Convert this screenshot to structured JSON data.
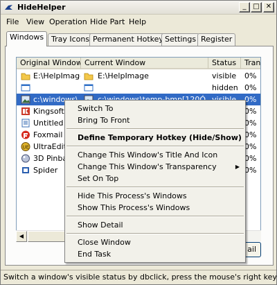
{
  "window": {
    "title": "HideHelper"
  },
  "menubar": [
    "File",
    "View",
    "Operation",
    "Hide Part",
    "Help"
  ],
  "tabs": [
    "Windows",
    "Tray Icons",
    "Permanent Hotkeys",
    "Settings",
    "Register"
  ],
  "list": {
    "columns": [
      "Original Window",
      "Current Window",
      "Status",
      "Tran"
    ],
    "rows": [
      {
        "original": "E:\\HelpImage",
        "current": "E:\\HelpImage",
        "status": "visible",
        "trans": "0%",
        "icon": "folder-icon"
      },
      {
        "original": "",
        "current": "",
        "status": "hidden",
        "trans": "0%",
        "icon": "blank-window-icon"
      },
      {
        "original": "c:\\windows\\",
        "current": "c:\\windows\\temp-bmp[120Ó",
        "status": "visible",
        "trans": "0%",
        "icon": "image-icon",
        "selected": true
      },
      {
        "original": "Kingsoft I",
        "current": "",
        "status": "",
        "trans": "0%",
        "icon": "kingsoft-icon"
      },
      {
        "original": "Untitled -",
        "current": "",
        "status": "",
        "trans": "0%",
        "icon": "notepad-icon"
      },
      {
        "original": "Foxmail",
        "current": "",
        "status": "",
        "trans": "0%",
        "icon": "foxmail-icon"
      },
      {
        "original": "UltraEdit-",
        "current": "",
        "status": "",
        "trans": "0%",
        "icon": "ultraedit-icon"
      },
      {
        "original": "3D Pinbal",
        "current": "",
        "status": "",
        "trans": "0%",
        "icon": "pinball-icon"
      },
      {
        "original": "Spider",
        "current": "",
        "status": "",
        "trans": "0%",
        "icon": "spider-icon"
      }
    ]
  },
  "detail_button": {
    "label": "ail"
  },
  "status_bar": {
    "text": "Switch a window's visible status by dbclick, press the mouse's right key to pop c"
  },
  "context_menu": {
    "items": [
      {
        "label": "Switch To"
      },
      {
        "label": "Bring To Front"
      },
      {
        "sep": true
      },
      {
        "label": "Define Temporary Hotkey (Hide/Show)",
        "bold": true
      },
      {
        "sep": true
      },
      {
        "label": "Change This Window's Title And Icon"
      },
      {
        "label": "Change This Window's Transparency",
        "submenu": true
      },
      {
        "label": "Set On Top"
      },
      {
        "sep": true
      },
      {
        "label": "Hide This Process's Windows"
      },
      {
        "label": "Show This Process's Windows"
      },
      {
        "sep": true
      },
      {
        "label": "Show Detail"
      },
      {
        "sep": true
      },
      {
        "label": "Close Window"
      },
      {
        "label": "End Task"
      }
    ]
  },
  "colors": {
    "selection": "#316ac5",
    "window_bg": "#ECE9D8",
    "list_border": "#7f9db9"
  }
}
